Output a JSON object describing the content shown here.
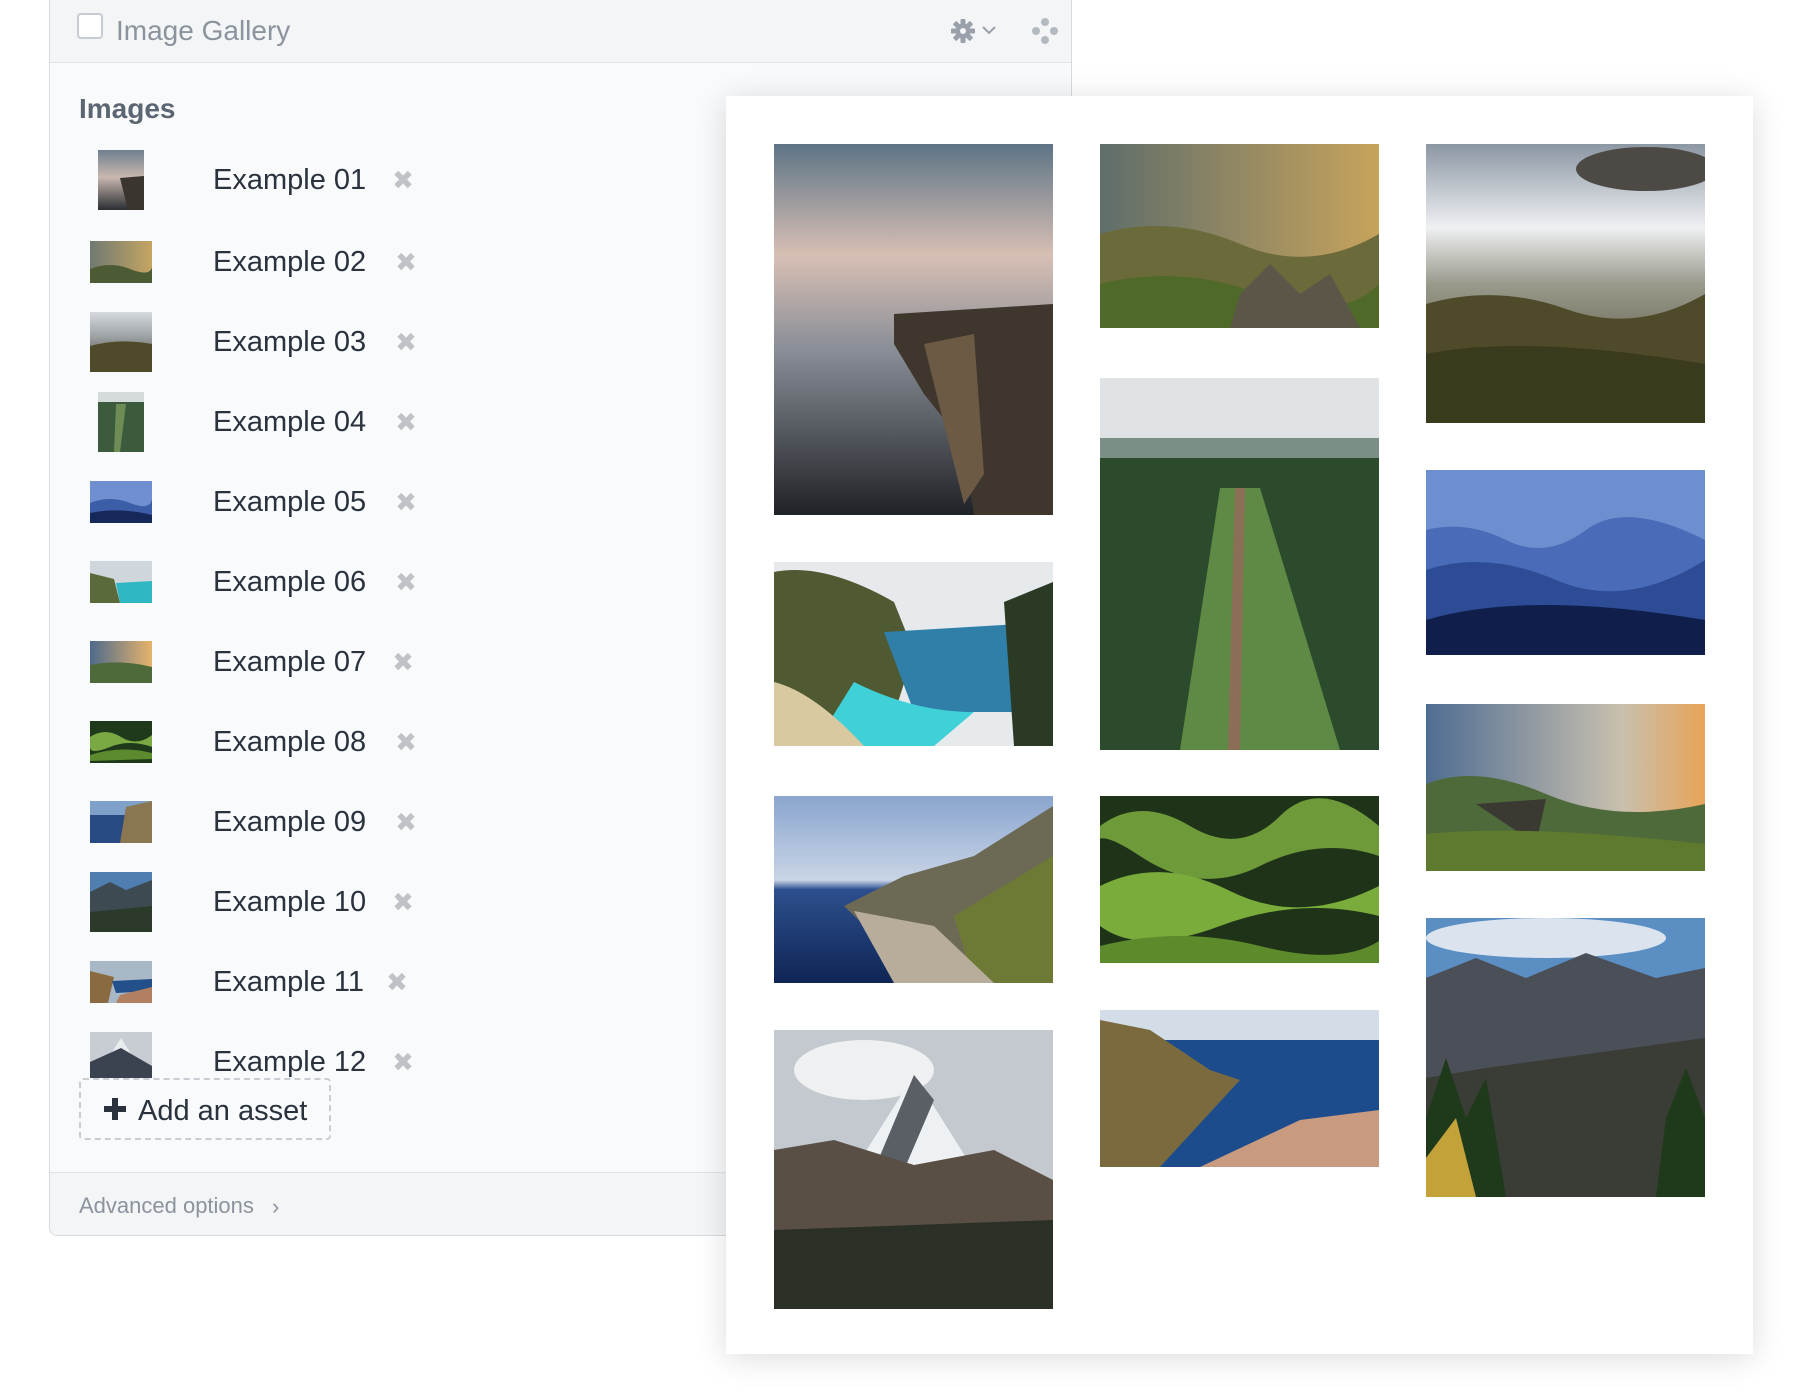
{
  "block": {
    "title": "Image Gallery",
    "section_label": "Images",
    "add_label": "Add an asset",
    "advanced_label": "Advanced options",
    "settings_icon": "gear-icon",
    "drag_icon": "drag-handle-icon",
    "remove_icon": "close-icon"
  },
  "assets": [
    {
      "name": "Example 01"
    },
    {
      "name": "Example 02"
    },
    {
      "name": "Example 03"
    },
    {
      "name": "Example 04"
    },
    {
      "name": "Example 05"
    },
    {
      "name": "Example 06"
    },
    {
      "name": "Example 07"
    },
    {
      "name": "Example 08"
    },
    {
      "name": "Example 09"
    },
    {
      "name": "Example 10"
    },
    {
      "name": "Example 11"
    },
    {
      "name": "Example 12"
    }
  ],
  "colors": {
    "panel_bg": "#f9fafb",
    "header_bg": "#f3f5f7",
    "border": "#d6dbe1",
    "muted_text": "#8b939d",
    "text": "#29323d"
  }
}
